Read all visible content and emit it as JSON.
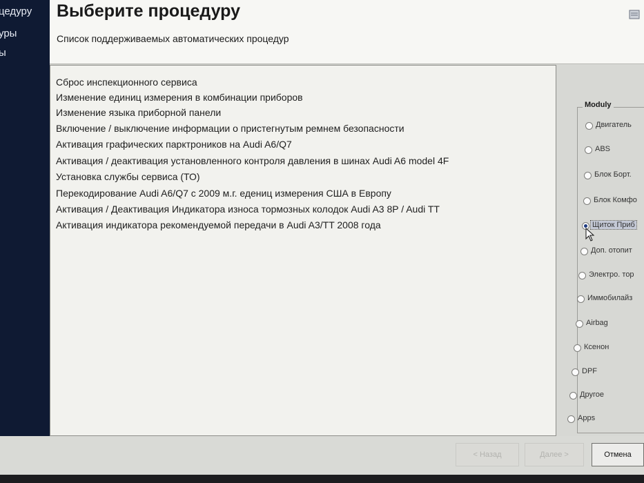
{
  "sidebar": {
    "items": [
      "цедуру",
      "уры",
      "ы"
    ]
  },
  "header": {
    "title": "Выберите процедуру",
    "subtitle": "Список поддерживаемых автоматических процедур"
  },
  "procedures": [
    "Сброс инспекционного сервиса",
    "Изменение единиц измерения в  комбинации приборов",
    "Изменение языка приборной панели",
    "Включение / выключение информации о пристегнутым ремнем безопасности",
    "Активация графических парктроников на Audi A6/Q7",
    "Активация  / деактивация установленного контроля давления в шинах Audi A6 model 4F",
    "Установка службы сервиса (ТО)",
    "Перекодирование Audi A6/Q7 с 2009 м.г. едениц измерения США в Европу",
    "Активация / Деактивация Индикатора износа тормозных колодок Audi A3 8P / Audi TT",
    "Активация индикатора рекомендуемой передачи в Audi A3/TT 2008 года"
  ],
  "modules": {
    "legend": "Moduly",
    "selected_index": 4,
    "options": [
      "Двигатель",
      "ABS",
      "Блок Борт.",
      "Блок Комфо",
      "Щиток Приб",
      "Доп. отопит",
      "Электро. тор",
      "Иммобилайз",
      "Airbag",
      "Ксенон",
      "DPF",
      "Другое",
      "Apps"
    ]
  },
  "buttons": {
    "back": "< Назад",
    "next": "Далее >",
    "cancel": "Отмена"
  },
  "colors": {
    "sidebar_bg": "#0f1a33",
    "header_bg": "#f7f7f4",
    "list_bg": "#f2f2ee",
    "window_bg": "#d7d8d4",
    "radio_dot": "#1f3c80"
  }
}
